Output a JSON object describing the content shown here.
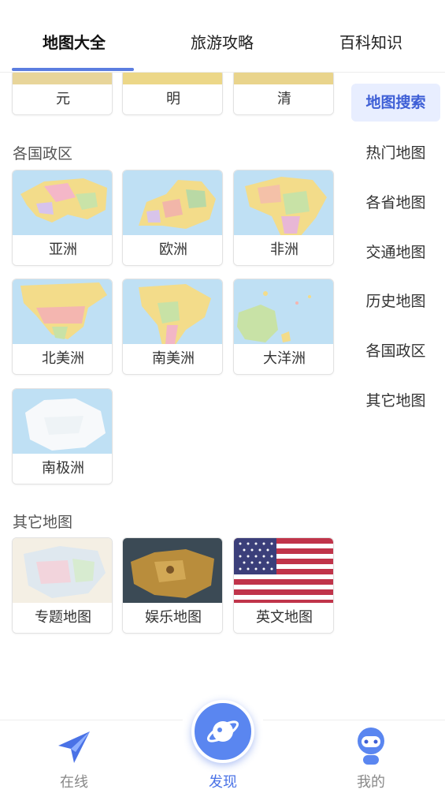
{
  "top_tabs": {
    "map_all": "地图大全",
    "travel": "旅游攻略",
    "encyclopedia": "百科知识"
  },
  "dynasty_cards": [
    "元",
    "明",
    "清"
  ],
  "sections": {
    "countries": {
      "title": "各国政区",
      "items": [
        "亚洲",
        "欧洲",
        "非洲",
        "北美洲",
        "南美洲",
        "大洋洲",
        "南极洲"
      ]
    },
    "other": {
      "title": "其它地图",
      "items": [
        "专题地图",
        "娱乐地图",
        "英文地图"
      ]
    }
  },
  "sidebar": {
    "items": [
      "地图搜索",
      "热门地图",
      "各省地图",
      "交通地图",
      "历史地图",
      "各国政区",
      "其它地图"
    ],
    "active_index": 0
  },
  "bottom_nav": {
    "online": "在线",
    "discover": "发现",
    "mine": "我的"
  },
  "colors": {
    "accent": "#4a72e6",
    "sidebar_active_bg": "#e8eeff",
    "map_sea": "#bfe0f4",
    "map_land": "#f3dc8a"
  },
  "icons": {
    "online": "paper-plane-icon",
    "discover": "planet-icon",
    "mine": "robot-avatar-icon"
  }
}
